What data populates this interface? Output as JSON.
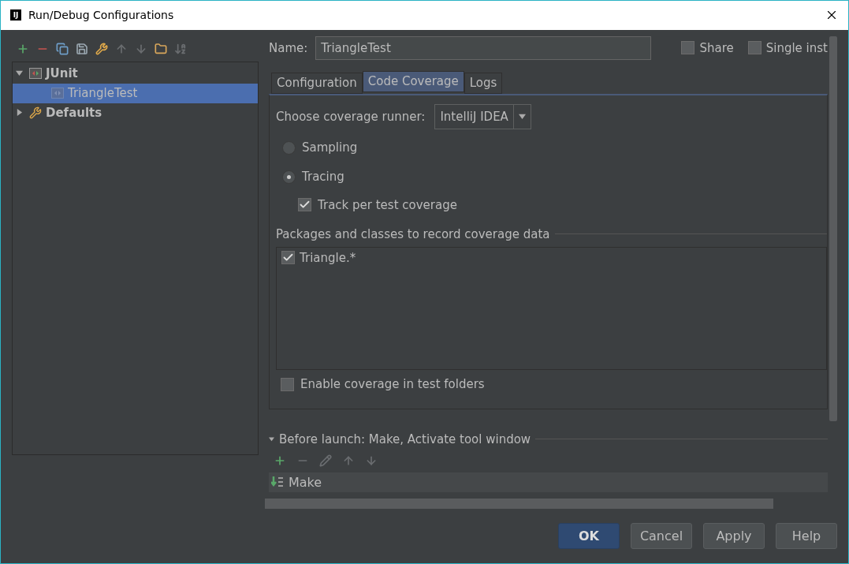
{
  "window": {
    "title": "Run/Debug Configurations",
    "logo": "IJ"
  },
  "toolbar": [
    {
      "kind": "add",
      "disabled": false
    },
    {
      "kind": "remove",
      "disabled": false
    },
    {
      "kind": "copy",
      "disabled": false
    },
    {
      "kind": "save",
      "disabled": false
    },
    {
      "kind": "wrench",
      "disabled": false
    },
    {
      "kind": "up",
      "disabled": true
    },
    {
      "kind": "down",
      "disabled": true
    },
    {
      "kind": "folder",
      "disabled": false
    },
    {
      "kind": "sort",
      "disabled": true
    }
  ],
  "tree": [
    {
      "kind": "junit",
      "label": "JUnit",
      "expanded": true,
      "selected": false,
      "children": [
        {
          "kind": "test",
          "label": "TriangleTest",
          "selected": true
        }
      ]
    },
    {
      "kind": "defaults",
      "label": "Defaults",
      "expanded": false,
      "selected": false
    }
  ],
  "name_field": {
    "label": "Name:",
    "value": "TriangleTest"
  },
  "header_checkboxes": [
    {
      "label": "Share",
      "checked": false
    },
    {
      "label": "Single inst",
      "checked": false
    }
  ],
  "tabs": [
    {
      "label": "Configuration",
      "selected": false
    },
    {
      "label": "Code Coverage",
      "selected": true
    },
    {
      "label": "Logs",
      "selected": false
    }
  ],
  "coverage": {
    "runner_label": "Choose coverage runner:",
    "runner_value": "IntelliJ IDEA",
    "modes": [
      {
        "label": "Sampling",
        "selected": false
      },
      {
        "label": "Tracing",
        "selected": true
      }
    ],
    "track": {
      "label": "Track per test coverage",
      "checked": true
    },
    "packages_title": "Packages and classes to record coverage data",
    "packages": [
      {
        "label": "Triangle.*",
        "checked": true
      }
    ],
    "enable_test_folders": {
      "label": "Enable coverage in test folders",
      "checked": false
    }
  },
  "before_launch": {
    "title": "Before launch: Make, Activate tool window",
    "expanded": true,
    "toolbar": [
      {
        "kind": "add",
        "disabled": false
      },
      {
        "kind": "remove",
        "disabled": true
      },
      {
        "kind": "edit",
        "disabled": true
      },
      {
        "kind": "up",
        "disabled": true
      },
      {
        "kind": "down",
        "disabled": true
      }
    ],
    "tasks": [
      {
        "label": "Make"
      }
    ]
  },
  "buttons": [
    {
      "label": "OK",
      "primary": true
    },
    {
      "label": "Cancel",
      "primary": false
    },
    {
      "label": "Apply",
      "primary": false
    },
    {
      "label": "Help",
      "primary": false
    }
  ]
}
